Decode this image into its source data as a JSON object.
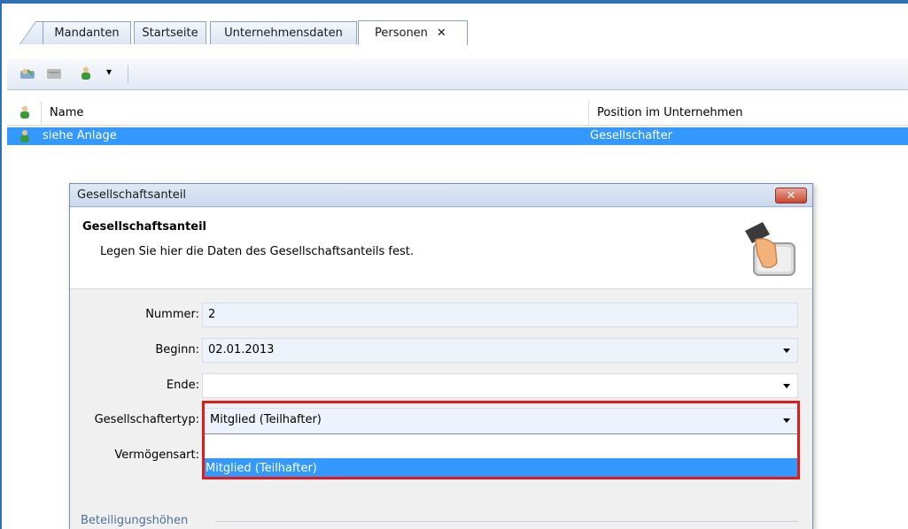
{
  "tabs": [
    {
      "label": "Mandanten"
    },
    {
      "label": "Startseite"
    },
    {
      "label": "Unternehmensdaten"
    },
    {
      "label": "Personen",
      "close": "✕",
      "active": true
    }
  ],
  "toolbar": {
    "icons": [
      "group-edit-icon",
      "card-icon",
      "person-add-icon",
      "dropdown-arrow-icon"
    ],
    "dropdown_arrow": "▾"
  },
  "grid": {
    "columns": [
      "Name",
      "Position im Unternehmen"
    ],
    "rows": [
      {
        "name": "siehe Anlage",
        "position": "Gesellschafter",
        "selected": true
      }
    ]
  },
  "dialog": {
    "title": "Gesellschaftsanteil",
    "close": "✕",
    "header_title": "Gesellschaftsanteil",
    "header_subtitle": "Legen Sie hier die Daten des Gesellschaftsanteils fest.",
    "fields": {
      "nummer_label": "Nummer:",
      "nummer_value": "2",
      "beginn_label": "Beginn:",
      "beginn_value": "02.01.2013",
      "ende_label": "Ende:",
      "ende_value": "",
      "typ_label": "Gesellschaftertyp:",
      "typ_value": "Mitglied (Teilhafter)",
      "vermoegen_label": "Vermögensart:"
    },
    "dropdown_options": [
      "",
      "Mitglied (Teilhafter)"
    ],
    "section": "Beteiligungshöhen"
  },
  "colors": {
    "selection": "#3399ff",
    "highlight": "#e11a1a",
    "frame": "#2f6fb6"
  }
}
